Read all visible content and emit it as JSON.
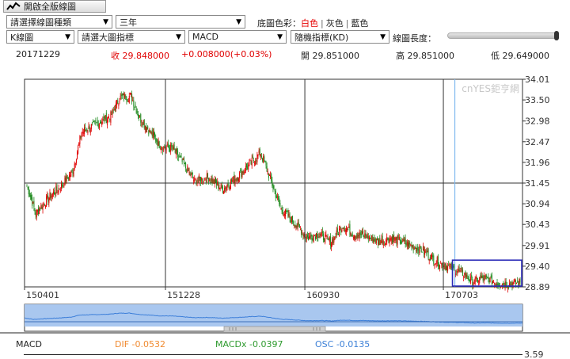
{
  "toolbar": {
    "fullscreen_label": "開啟全版線圖",
    "chart_type_select": "請選擇線圖種類",
    "period_select": "三年",
    "bg_color_label": "底圖色彩：",
    "bg_colors": [
      "白色",
      "灰色",
      "藍色"
    ],
    "candle_select": "K線圖",
    "main_indicator_select": "請選大圖指標",
    "sub_indicator_select": "MACD",
    "stochastic_select": "隨機指標(KD)",
    "length_label": "線圖長度："
  },
  "quote": {
    "date": "20171229",
    "close_label": "收",
    "close": "29.848000",
    "change": "+0.008000(+0.03%)",
    "open_label": "開",
    "open": "29.851000",
    "high_label": "高",
    "high": "29.851000",
    "low_label": "低",
    "low": "29.649000"
  },
  "watermark": "cnYES鉅亨網",
  "colors": {
    "up": "#e00000",
    "down": "#1f8a1f",
    "axis": "#333333",
    "crosshair": "#7fb8ef",
    "highlight": "#2b2bb8"
  },
  "chart_data": {
    "type": "candlestick",
    "yticks": [
      34.01,
      33.5,
      32.98,
      32.47,
      31.96,
      31.45,
      30.94,
      30.43,
      29.91,
      29.4,
      28.89
    ],
    "ylim": [
      28.89,
      34.01
    ],
    "xticks": [
      "150401",
      "151228",
      "160930",
      "170703"
    ],
    "reference_line": 31.45,
    "anchors": [
      [
        0,
        31.4
      ],
      [
        10,
        30.7
      ],
      [
        25,
        31.1
      ],
      [
        40,
        31.4
      ],
      [
        52,
        31.75
      ],
      [
        62,
        32.7
      ],
      [
        78,
        32.9
      ],
      [
        95,
        33.1
      ],
      [
        105,
        33.55
      ],
      [
        118,
        33.6
      ],
      [
        128,
        33.05
      ],
      [
        140,
        32.7
      ],
      [
        152,
        32.35
      ],
      [
        165,
        32.3
      ],
      [
        178,
        31.9
      ],
      [
        190,
        31.5
      ],
      [
        205,
        31.6
      ],
      [
        222,
        31.3
      ],
      [
        238,
        31.6
      ],
      [
        252,
        31.9
      ],
      [
        265,
        32.2
      ],
      [
        275,
        31.6
      ],
      [
        288,
        30.8
      ],
      [
        302,
        30.5
      ],
      [
        318,
        30.1
      ],
      [
        330,
        30.2
      ],
      [
        345,
        30.0
      ],
      [
        358,
        30.4
      ],
      [
        370,
        30.2
      ],
      [
        385,
        30.15
      ],
      [
        398,
        30.0
      ],
      [
        412,
        30.1
      ],
      [
        425,
        30.0
      ],
      [
        436,
        29.9
      ],
      [
        448,
        29.8
      ],
      [
        462,
        29.55
      ],
      [
        475,
        29.4
      ],
      [
        486,
        29.3
      ],
      [
        496,
        29.2
      ],
      [
        505,
        29.0
      ],
      [
        515,
        29.1
      ],
      [
        525,
        29.05
      ],
      [
        535,
        28.98
      ],
      [
        547,
        28.96
      ],
      [
        559,
        29.0
      ]
    ],
    "highlight_box": {
      "x_from": 485,
      "x_to": 559,
      "y_from": 28.89,
      "y_to": 29.55
    },
    "crosshair_index": 485
  },
  "macd": {
    "label": "MACD",
    "dif": "DIF -0.0532",
    "macdx": "MACDx -0.0397",
    "osc": "OSC -0.0135",
    "top_value": "3.59"
  },
  "macd_colors": {
    "dif": "#f08a30",
    "macdx": "#2e9a2e",
    "osc": "#3b7fd6"
  }
}
